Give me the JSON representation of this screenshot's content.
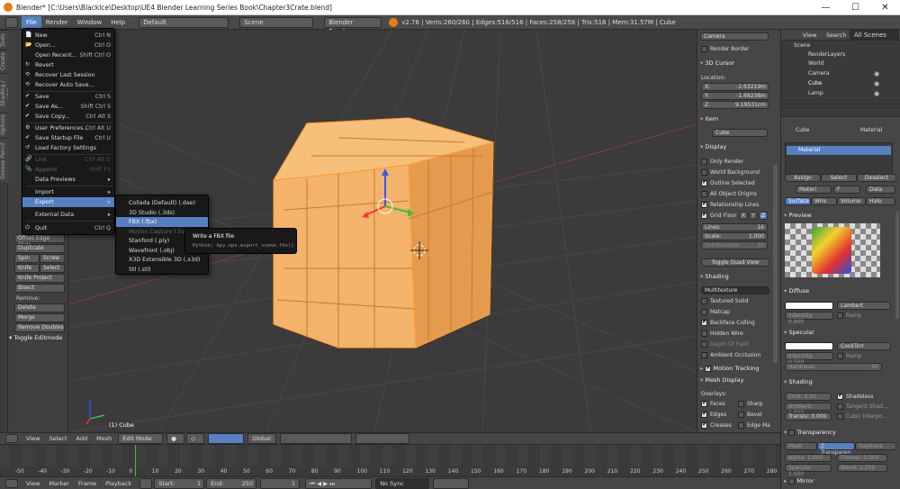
{
  "window": {
    "title": "Blender* [C:\\Users\\Blacklce\\Desktop\\UE4 Blender Learning Series Book\\Chapter3Crate.blend]",
    "controls": [
      "—",
      "☐",
      "✕"
    ]
  },
  "infobar": {
    "menus": [
      "File",
      "Render",
      "Window",
      "Help"
    ],
    "layout": "Default",
    "scene": "Scene",
    "engine": "Blender Render",
    "stats": "v2.76 | Verts:260/260 | Edges:516/516 | Faces:258/258 | Tris:516 | Mem:31.57M | Cube"
  },
  "file_menu": {
    "items": [
      {
        "label": "New",
        "shortcut": "Ctrl N"
      },
      {
        "label": "Open...",
        "shortcut": "Ctrl O"
      },
      {
        "label": "Open Recent...",
        "shortcut": "Shift Ctrl O"
      },
      {
        "label": "Revert",
        "shortcut": ""
      },
      {
        "label": "Recover Last Session",
        "shortcut": ""
      },
      {
        "label": "Recover Auto Save...",
        "shortcut": ""
      },
      {
        "label": "Save",
        "shortcut": "Ctrl S"
      },
      {
        "label": "Save As...",
        "shortcut": "Shift Ctrl S"
      },
      {
        "label": "Save Copy...",
        "shortcut": "Ctrl Alt S"
      },
      {
        "label": "User Preferences...",
        "shortcut": "Ctrl Alt U"
      },
      {
        "label": "Save Startup File",
        "shortcut": "Ctrl U"
      },
      {
        "label": "Load Factory Settings",
        "shortcut": ""
      },
      {
        "label": "Link",
        "shortcut": "Ctrl Alt O"
      },
      {
        "label": "Append",
        "shortcut": "Shift F1"
      },
      {
        "label": "Data Previews",
        "shortcut": "▸"
      },
      {
        "label": "Import",
        "shortcut": "▸"
      },
      {
        "label": "Export",
        "shortcut": "▸"
      },
      {
        "label": "External Data",
        "shortcut": "▸"
      },
      {
        "label": "Quit",
        "shortcut": "Ctrl Q"
      }
    ]
  },
  "export_menu": {
    "items": [
      {
        "label": "Collada (Default) (.dae)"
      },
      {
        "label": "3D Studio (.3ds)"
      },
      {
        "label": "FBX (.fbx)"
      },
      {
        "label": "Motion Capture (.bvh)"
      },
      {
        "label": "Stanford (.ply)"
      },
      {
        "label": "Wavefront (.obj)"
      },
      {
        "label": "X3D Extensible 3D (.x3d)"
      },
      {
        "label": "Stl (.stl)"
      }
    ]
  },
  "tooltip": {
    "title": "Write a FBX file",
    "python": "Python: bpy.ops.export_scene.fbx()"
  },
  "tool_shelf": {
    "tabs": [
      "Tools",
      "Create",
      "Shading / UVs",
      "Options",
      "Grease Pencil"
    ],
    "buttons": [
      "Offset Edge Slide",
      "Duplicate",
      "Spin",
      "Screw",
      "Knife",
      "Select",
      "Knife Project",
      "Bisect"
    ],
    "remove_label": "Remove:",
    "delete": "Delete",
    "merge": "Merge",
    "remove_doubles": "Remove Doubles",
    "toggle_editmode": "Toggle Editmode"
  },
  "viewport": {
    "object_label": "(1) Cube"
  },
  "npanel": {
    "camera": "Camera",
    "render_border": "Render Border",
    "cursor_title": "3D Cursor",
    "location": "Location:",
    "x": "X:",
    "x_val": "-2.63219m",
    "y": "Y:",
    "y_val": "-1.68238m",
    "z": "Z:",
    "z_val": "9.19531cm",
    "item_title": "Item",
    "item_name": "Cube",
    "display_title": "Display",
    "only_render": "Only Render",
    "world_bg": "World Background",
    "outline_sel": "Outline Selected",
    "all_origins": "All Object Origins",
    "rel_lines": "Relationship Lines",
    "grid_floor": "Grid Floor",
    "axes": [
      "X",
      "Y",
      "Z"
    ],
    "lines": "Lines:",
    "lines_val": "16",
    "scale": "Scale:",
    "scale_val": "1.000",
    "subdiv": "Subdivisions:",
    "subdiv_val": "10",
    "toggle_quad": "Toggle Quad View",
    "shading_title": "Shading",
    "shading_mode": "Multitexture",
    "textured_solid": "Textured Solid",
    "matcap": "Matcap",
    "backface": "Backface Culling",
    "hidden_wire": "Hidden Wire",
    "dof": "Depth Of Field",
    "ao": "Ambient Occlusion",
    "motion_tracking": "Motion Tracking",
    "mesh_display": "Mesh Display",
    "overlays": "Overlays:",
    "faces": "Faces",
    "sharp": "Sharp",
    "edges": "Edges",
    "bevel": "Bevel",
    "creases": "Creases",
    "edge_ma": "Edge Ma"
  },
  "outliner": {
    "view": "View",
    "search": "Search",
    "all_scenes": "All Scenes",
    "items": [
      "Scene",
      "RenderLayers",
      "World",
      "Camera",
      "Cube",
      "Lamp"
    ]
  },
  "props": {
    "cube": "Cube",
    "material_tab": "Material",
    "slot": "Material",
    "assign": "Assign",
    "select": "Select",
    "deselect": "Deselect",
    "mat_name": "Materi",
    "f": "F",
    "data": "Data",
    "tabs": [
      "Surface",
      "Wire",
      "Volume",
      "Halo"
    ],
    "preview": "Preview",
    "diffuse": "Diffuse",
    "lambert": "Lambert",
    "intensity": "Intensity: 0.800",
    "ramp": "Ramp",
    "specular": "Specular",
    "cooktorr": "CookTorr",
    "intensity2": "Intensity: 0.500",
    "ramp2": "Ramp",
    "hardness": "Hardness:",
    "hardness_val": "50",
    "shading": "Shading",
    "emit": "Emit: 0.00",
    "shadeless": "Shadeless",
    "ambient": "Ambient: 1.000",
    "tangent": "Tangent Shad...",
    "translu": "Translu: 0.000",
    "cubic": "Cubic Interpo...",
    "transparency": "Transparency",
    "mask": "Mask",
    "ztransp": "Z Transparen",
    "raytrace": "Raytrace",
    "alpha": "Alpha: 1.000",
    "fresnel": "Fresnel: 0.000",
    "specula": "Specula: 1.000",
    "blend": "Blend: 1.250",
    "mirror": "Mirror"
  },
  "vpheader": {
    "view": "View",
    "select": "Select",
    "add": "Add",
    "mesh": "Mesh",
    "mode": "Edit Mode",
    "orientation": "Global"
  },
  "timeline": {
    "ticks": [
      "-50",
      "-40",
      "-30",
      "-20",
      "-10",
      "0",
      "10",
      "20",
      "30",
      "40",
      "50",
      "60",
      "70",
      "80",
      "90",
      "100",
      "110",
      "120",
      "130",
      "140",
      "150",
      "160",
      "170",
      "180",
      "190",
      "200",
      "210",
      "220",
      "230",
      "240",
      "250",
      "260",
      "270",
      "280"
    ]
  },
  "tlheader": {
    "view": "View",
    "marker": "Marker",
    "frame": "Frame",
    "playback": "Playback",
    "start": "Start:",
    "start_val": "1",
    "end": "End:",
    "end_val": "250",
    "current": "1",
    "sync": "No Sync"
  }
}
